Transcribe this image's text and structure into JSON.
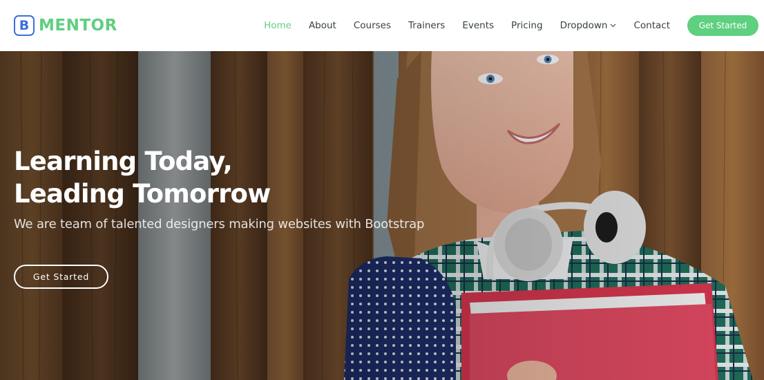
{
  "brand": {
    "logo_letter": "B",
    "name": "MENTOR"
  },
  "nav": {
    "items": [
      {
        "label": "Home",
        "active": true
      },
      {
        "label": "About"
      },
      {
        "label": "Courses"
      },
      {
        "label": "Trainers"
      },
      {
        "label": "Events"
      },
      {
        "label": "Pricing"
      },
      {
        "label": "Dropdown",
        "has_dropdown": true
      },
      {
        "label": "Contact"
      }
    ],
    "cta_label": "Get Started"
  },
  "hero": {
    "title_line1": "Learning Today,",
    "title_line2": "Leading Tomorrow",
    "subtitle": "We are team of talented designers making websites with Bootstrap",
    "button_label": "Get Started"
  },
  "colors": {
    "accent": "#5fcf80",
    "logo_blue": "#3b6fd8",
    "nav_text": "#37423b",
    "white": "#ffffff"
  },
  "icons": {
    "dropdown": "chevron-down-icon"
  }
}
